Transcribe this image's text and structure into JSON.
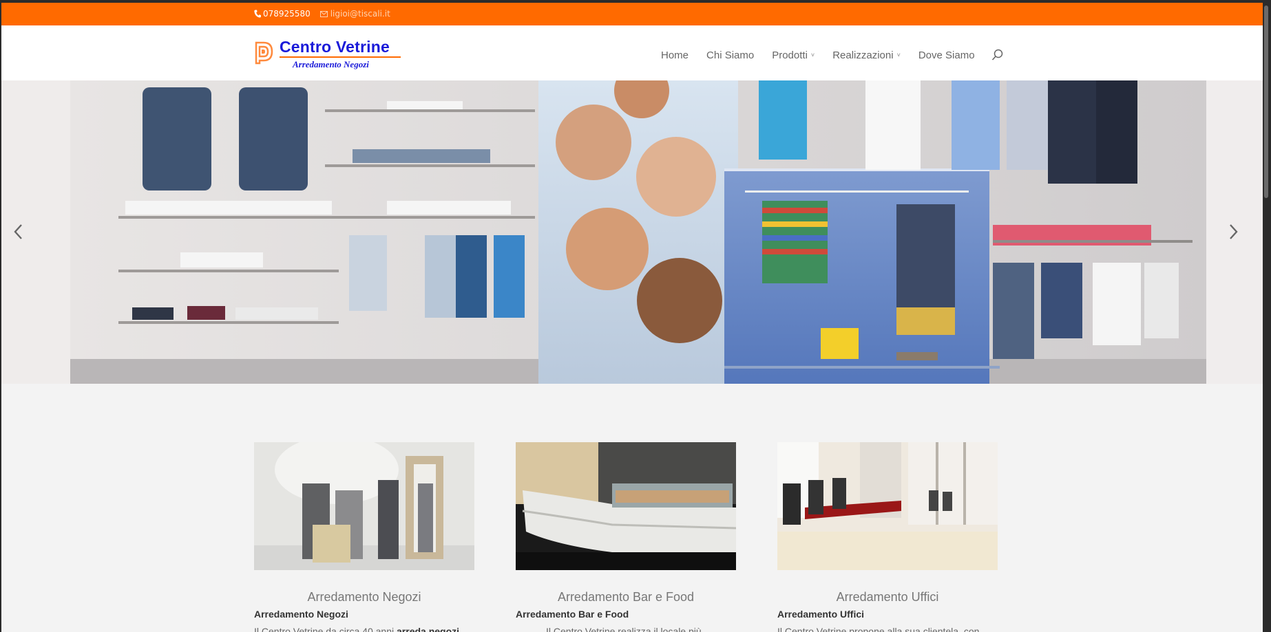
{
  "topbar": {
    "phone": "078925580",
    "email": "ligioi@tiscali.it",
    "bg_color": "#ff6a00",
    "phone_icon": "phone-icon",
    "email_icon": "envelope-icon"
  },
  "logo": {
    "title": "Centro Vetrine",
    "subtitle": "Arredamento Negozi",
    "brand_color": "#1a1ad9",
    "accent_color": "#ff6a00"
  },
  "nav": {
    "items": [
      {
        "label": "Home",
        "dropdown": false
      },
      {
        "label": "Chi Siamo",
        "dropdown": false
      },
      {
        "label": "Prodotti",
        "dropdown": true
      },
      {
        "label": "Realizzazioni",
        "dropdown": true
      },
      {
        "label": "Dove Siamo",
        "dropdown": false
      }
    ],
    "caret": "˅",
    "search_icon": "search-icon"
  },
  "slider": {
    "prev_icon": "chevron-left-icon",
    "next_icon": "chevron-right-icon"
  },
  "features": [
    {
      "heading": "Arredamento Negozi",
      "subheading": "Arredamento Negozi",
      "body_prefix": "Il Centro Vetrine da circa 40 anni ",
      "body_bold": "arreda negozi",
      "body_suffix": ""
    },
    {
      "heading": "Arredamento Bar e Food",
      "subheading": "Arredamento Bar e Food",
      "body_prefix": "Il Centro Vetrine realizza il locale più",
      "body_bold": "",
      "body_suffix": ""
    },
    {
      "heading": "Arredamento Uffici",
      "subheading": "Arredamento Uffici",
      "body_prefix": "Il Centro Vetrine propone alla sua clientela, con",
      "body_bold": "",
      "body_suffix": ""
    }
  ]
}
